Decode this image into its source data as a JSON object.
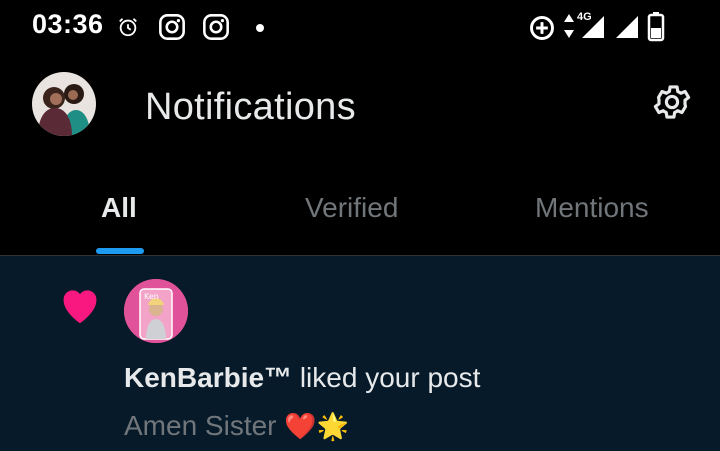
{
  "status_bar": {
    "time": "03:36",
    "network": "4G"
  },
  "header": {
    "title": "Notifications"
  },
  "tabs": [
    {
      "label": "All",
      "active": true
    },
    {
      "label": "Verified",
      "active": false
    },
    {
      "label": "Mentions",
      "active": false
    }
  ],
  "notification": {
    "user": "KenBarbie™",
    "action": " liked your post",
    "post_text": "Amen Sister ",
    "post_emojis": "❤️🌟",
    "icon": "heart-icon"
  },
  "colors": {
    "accent": "#1d9bf0",
    "heart": "#f91880",
    "notif_bg": "#061a29",
    "muted": "#71767b"
  }
}
